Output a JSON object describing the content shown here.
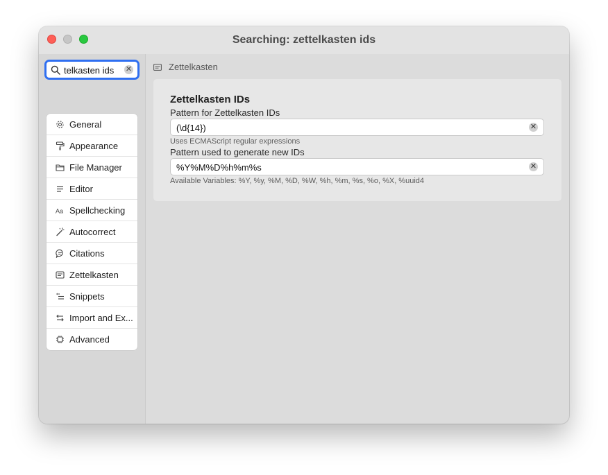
{
  "window": {
    "title": "Searching: zettelkasten ids"
  },
  "search": {
    "value": "telkasten ids",
    "clear_glyph": "✕"
  },
  "sidebar": {
    "items": [
      {
        "label": "General",
        "icon": "gear-icon"
      },
      {
        "label": "Appearance",
        "icon": "paint-roller-icon"
      },
      {
        "label": "File Manager",
        "icon": "folder-icon"
      },
      {
        "label": "Editor",
        "icon": "lines-icon"
      },
      {
        "label": "Spellchecking",
        "icon": "text-aa-icon"
      },
      {
        "label": "Autocorrect",
        "icon": "magic-wand-icon"
      },
      {
        "label": "Citations",
        "icon": "quote-bubble-icon"
      },
      {
        "label": "Zettelkasten",
        "icon": "note-card-icon"
      },
      {
        "label": "Snippets",
        "icon": "snippet-list-icon"
      },
      {
        "label": "Import and Ex...",
        "icon": "arrows-exchange-icon"
      },
      {
        "label": "Advanced",
        "icon": "chip-icon"
      }
    ]
  },
  "breadcrumb": {
    "label": "Zettelkasten"
  },
  "panel": {
    "title": "Zettelkasten IDs",
    "pattern_label": "Pattern for Zettelkasten IDs",
    "pattern_value": "(\\d{14})",
    "pattern_hint": "Uses ECMAScript regular expressions",
    "generator_label": "Pattern used to generate new IDs",
    "generator_value": "%Y%M%D%h%m%s",
    "generator_hint": "Available Variables: %Y, %y, %M, %D, %W, %h, %m, %s, %o, %X, %uuid4",
    "clear_glyph": "✕"
  },
  "colors": {
    "accent": "#2f6ff1",
    "close": "#fe5f57",
    "minimize_inactive": "#c6c6c6",
    "maximize": "#29c840"
  }
}
